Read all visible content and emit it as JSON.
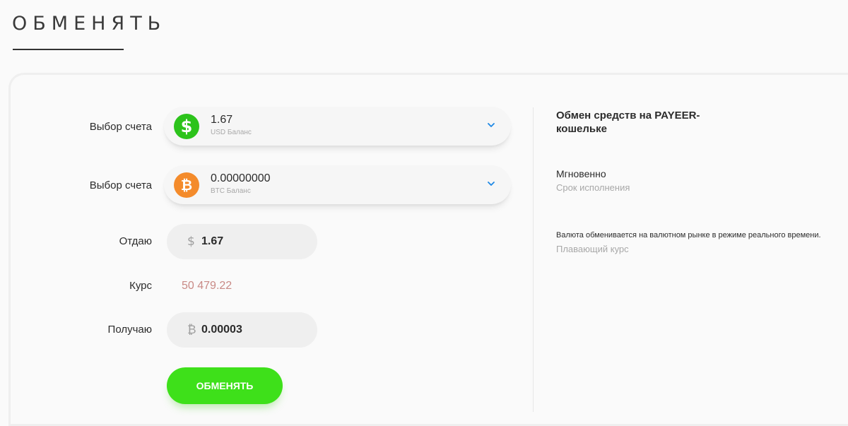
{
  "page": {
    "title": "ОБМЕНЯТЬ"
  },
  "form": {
    "from_account": {
      "label": "Выбор счета",
      "amount": "1.67",
      "balance_label": "USD Баланс",
      "icon": "dollar-coin-icon",
      "color": "#2cc31b",
      "symbol": "$"
    },
    "to_account": {
      "label": "Выбор счета",
      "amount": "0.00000000",
      "balance_label": "BTC Баланс",
      "icon": "bitcoin-coin-icon",
      "color": "#f48b2b",
      "symbol": "₿"
    },
    "give": {
      "label": "Отдаю",
      "symbol": "$",
      "value": "1.67"
    },
    "rate": {
      "label": "Курс",
      "value": "50 479.22"
    },
    "receive": {
      "label": "Получаю",
      "symbol": "₿",
      "value": "0.00003"
    },
    "submit_label": "ОБМЕНЯТЬ"
  },
  "info": {
    "title": "Обмен средств на PAYEER-кошельке",
    "speed": {
      "value": "Мгновенно",
      "caption": "Срок исполнения"
    },
    "rate_type": {
      "value": "Валюта обменивается на валютном рынке в режиме реального времени.",
      "caption": "Плавающий курс"
    }
  },
  "colors": {
    "accent_green": "#3ee01a",
    "rate_text": "#c98a86",
    "chevron": "#1e88e5"
  }
}
